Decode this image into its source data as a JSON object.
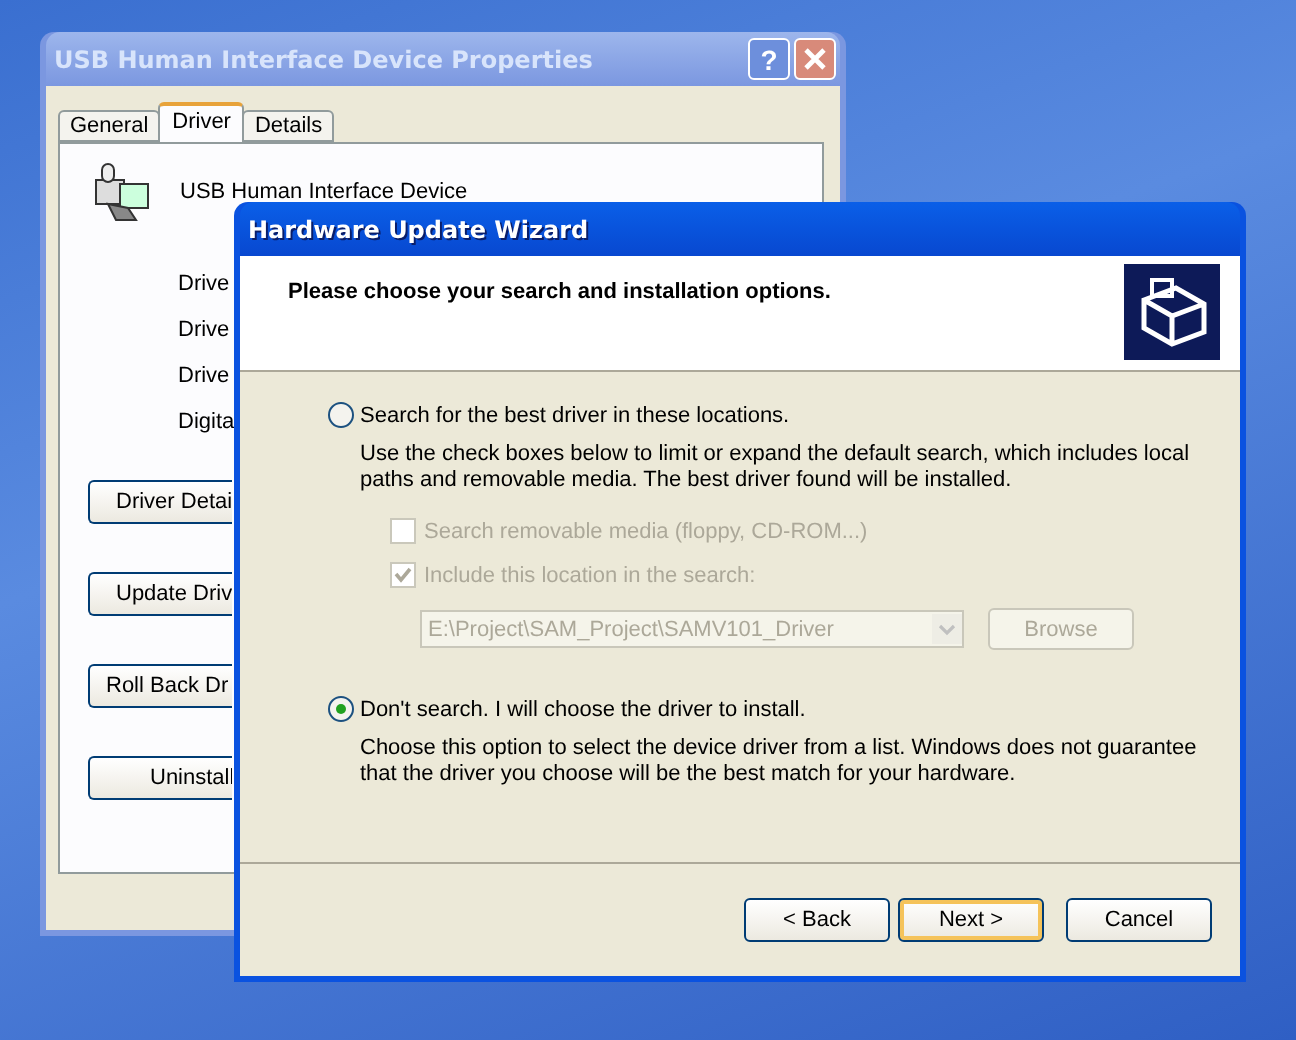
{
  "back_window": {
    "title": "USB Human Interface Device Properties",
    "help": "?",
    "tabs": [
      {
        "label": "General",
        "selected": false
      },
      {
        "label": "Driver",
        "selected": true
      },
      {
        "label": "Details",
        "selected": false
      }
    ],
    "device_name": "USB Human Interface Device",
    "labels": [
      "Drive",
      "Drive",
      "Drive",
      "Digita"
    ],
    "buttons": [
      "Driver Detai",
      "Update Driv",
      "Roll Back Dr",
      "Uninstall"
    ]
  },
  "wizard": {
    "title": "Hardware Update Wizard",
    "heading": "Please choose your search and installation options.",
    "options": [
      {
        "label": "Search for the best driver in these locations.",
        "selected": false,
        "description": "Use the check boxes below to limit or expand the default search, which includes local paths and removable media. The best driver found will be installed."
      },
      {
        "label": "Don't search. I will choose the driver to install.",
        "selected": true,
        "description": "Choose this option to select the device driver from a list.  Windows does not guarantee that the driver you choose will be the best match for your hardware."
      }
    ],
    "search_options": [
      {
        "label": "Search removable media (floppy, CD-ROM...)",
        "checked": false,
        "disabled": true
      },
      {
        "label": "Include this location in the search:",
        "checked": true,
        "disabled": true
      }
    ],
    "location": {
      "value": "E:\\Project\\SAM_Project\\SAMV101_Driver",
      "disabled": true
    },
    "browse": "Browse",
    "buttons": [
      {
        "label": "< Back",
        "default": false
      },
      {
        "label": "Next >",
        "default": true
      },
      {
        "label": "Cancel",
        "default": false
      }
    ]
  }
}
